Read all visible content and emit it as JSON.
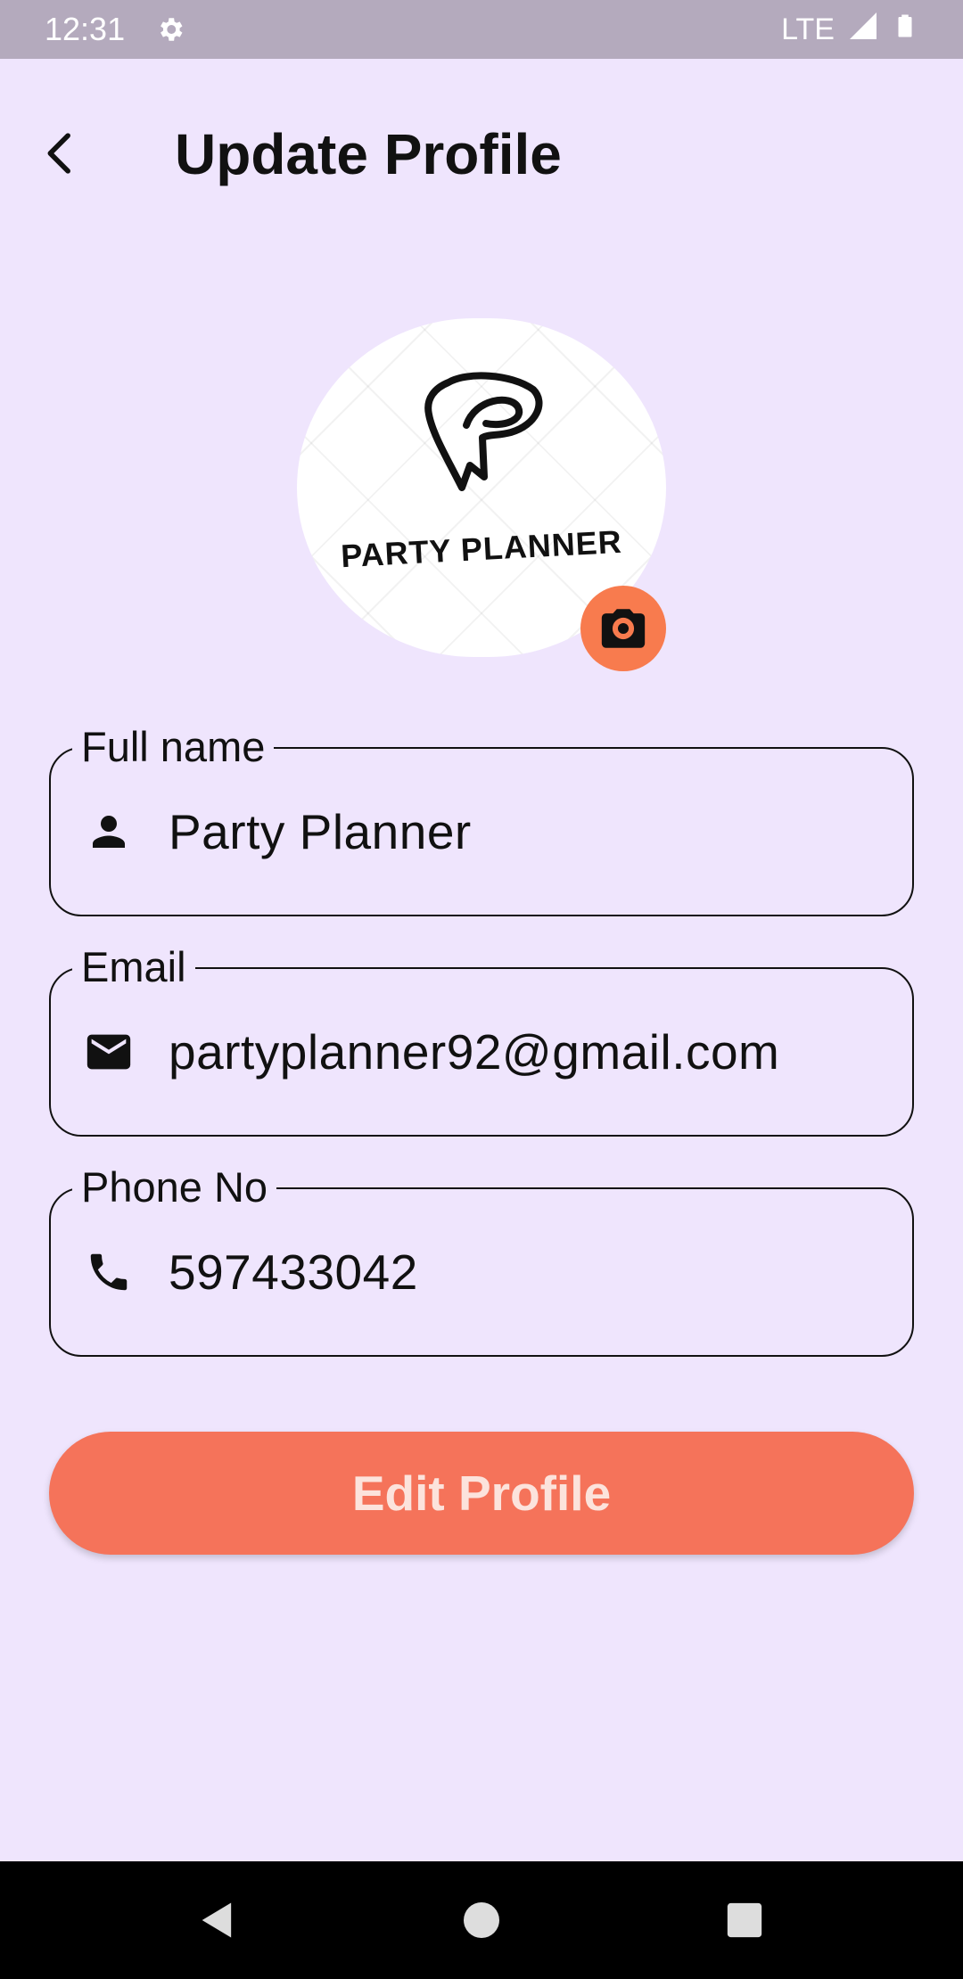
{
  "status_bar": {
    "time": "12:31",
    "network": "LTE"
  },
  "header": {
    "title": "Update Profile"
  },
  "avatar": {
    "logo_text": "PARTY PLANNER"
  },
  "fields": {
    "full_name": {
      "label": "Full name",
      "value": "Party Planner",
      "icon": "person-icon"
    },
    "email": {
      "label": "Email",
      "value": "partyplanner92@gmail.com",
      "icon": "mail-icon"
    },
    "phone": {
      "label": "Phone No",
      "value": "597433042",
      "icon": "phone-icon"
    }
  },
  "actions": {
    "edit_label": "Edit Profile"
  },
  "colors": {
    "background": "#EFE5FD",
    "status_bar": "#B4AABD",
    "accent": "#F5735A",
    "camera_button": "#F87B4E"
  }
}
